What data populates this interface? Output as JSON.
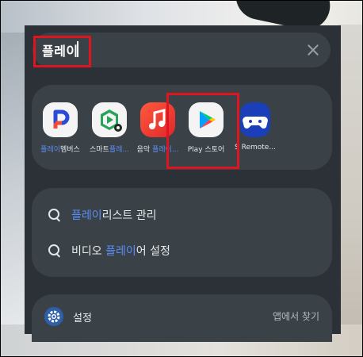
{
  "search": {
    "query": "플레이"
  },
  "apps": [
    {
      "name_highlight": "플레이",
      "name_rest": "멤버스",
      "icon": "play-members-icon"
    },
    {
      "name_plain": "스마트",
      "name_highlight": "플레...",
      "icon": "smart-play-icon"
    },
    {
      "name_plain": "음악 ",
      "name_highlight": "플레이...",
      "icon": "music-player-icon"
    },
    {
      "name_plain": "Play 스토어",
      "icon": "play-store-icon"
    },
    {
      "name_plain": "S Remote...",
      "icon": "s-remote-icon"
    }
  ],
  "results": [
    {
      "highlight": "플레이",
      "rest": "리스트 관리"
    },
    {
      "prefix": "비디오 ",
      "highlight": "플레이",
      "rest": "어 설정"
    }
  ],
  "settings": {
    "label": "설정",
    "find_in_apps": "앱에서 찾기"
  },
  "colors": {
    "panel": "#2b3136",
    "card": "#3b4247",
    "highlight": "#5a8df5",
    "annotation": "#e0141e"
  }
}
